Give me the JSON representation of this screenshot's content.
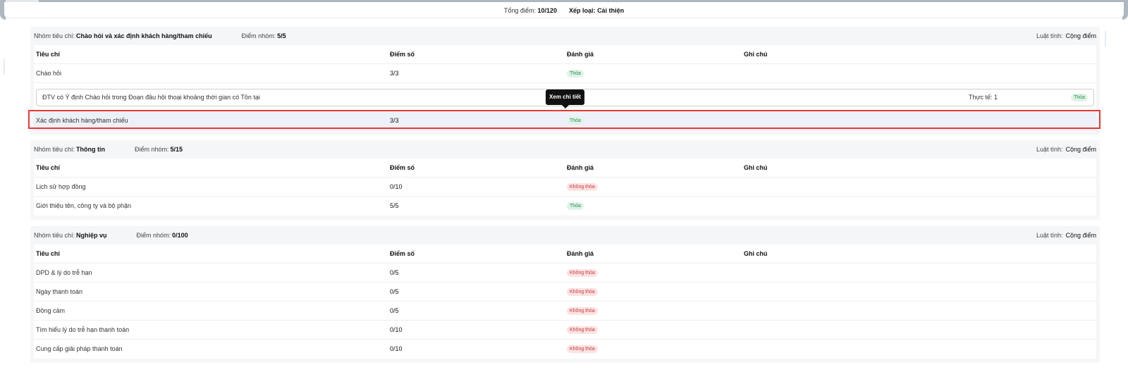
{
  "summary": {
    "total_label": "Tổng điểm:",
    "total_value": "10/120",
    "rank_label": "Xếp loại:",
    "rank_value": "Cải thiện"
  },
  "columns": {
    "criterion": "Tiêu chí",
    "score": "Điểm số",
    "evaluation": "Đánh giá",
    "note": "Ghi chú"
  },
  "group_label": "Nhóm tiêu chí:",
  "group_score_label": "Điểm nhóm:",
  "rule_label": "Luật tính:",
  "groups": [
    {
      "name": "Chào hỏi và xác định khách hàng/tham chiếu",
      "score": "5/5",
      "rule": "Cộng điểm",
      "rows": [
        {
          "criterion": "Chào hỏi",
          "score": "3/3",
          "evaluation": "Thỏa",
          "status": "pass"
        },
        {
          "criterion": "Xác định khách hàng/tham chiếu",
          "score": "3/3",
          "evaluation": "Thỏa",
          "status": "pass"
        }
      ],
      "detail": {
        "text": "ĐTV có Ý định Chào hỏi trong Đoạn đầu hội thoại khoảng thời gian có Tồn tại",
        "actual": "Thực tế: 1",
        "evaluation": "Thỏa"
      }
    },
    {
      "name": "Thông tin",
      "score": "5/15",
      "rule": "Cộng điểm",
      "rows": [
        {
          "criterion": "Lịch sử hợp đồng",
          "score": "0/10",
          "evaluation": "Không thỏa",
          "status": "fail"
        },
        {
          "criterion": "Giới thiệu tên, công ty và bộ phận",
          "score": "5/5",
          "evaluation": "Thỏa",
          "status": "pass"
        }
      ]
    },
    {
      "name": "Nghiệp vụ",
      "score": "0/100",
      "rule": "Cộng điểm",
      "rows": [
        {
          "criterion": "DPD & lý do trễ hạn",
          "score": "0/5",
          "evaluation": "Không thỏa",
          "status": "fail"
        },
        {
          "criterion": "Ngày thanh toán",
          "score": "0/5",
          "evaluation": "Không thỏa",
          "status": "fail"
        },
        {
          "criterion": "Đồng cảm",
          "score": "0/5",
          "evaluation": "Không thỏa",
          "status": "fail"
        },
        {
          "criterion": "Tìm hiểu lý do trễ hạn thanh toán",
          "score": "0/10",
          "evaluation": "Không thỏa",
          "status": "fail"
        },
        {
          "criterion": "Cung cấp giải pháp thanh toán",
          "score": "0/10",
          "evaluation": "Không thỏa",
          "status": "fail"
        }
      ]
    }
  ],
  "tooltip": {
    "text": "Xem chi tiết"
  },
  "colors": {
    "pass_bg": "#dff3e7",
    "pass_text": "#2f8a53",
    "fail_bg": "#fde2e2",
    "fail_text": "#c43b3b",
    "focus": "#e53935"
  }
}
